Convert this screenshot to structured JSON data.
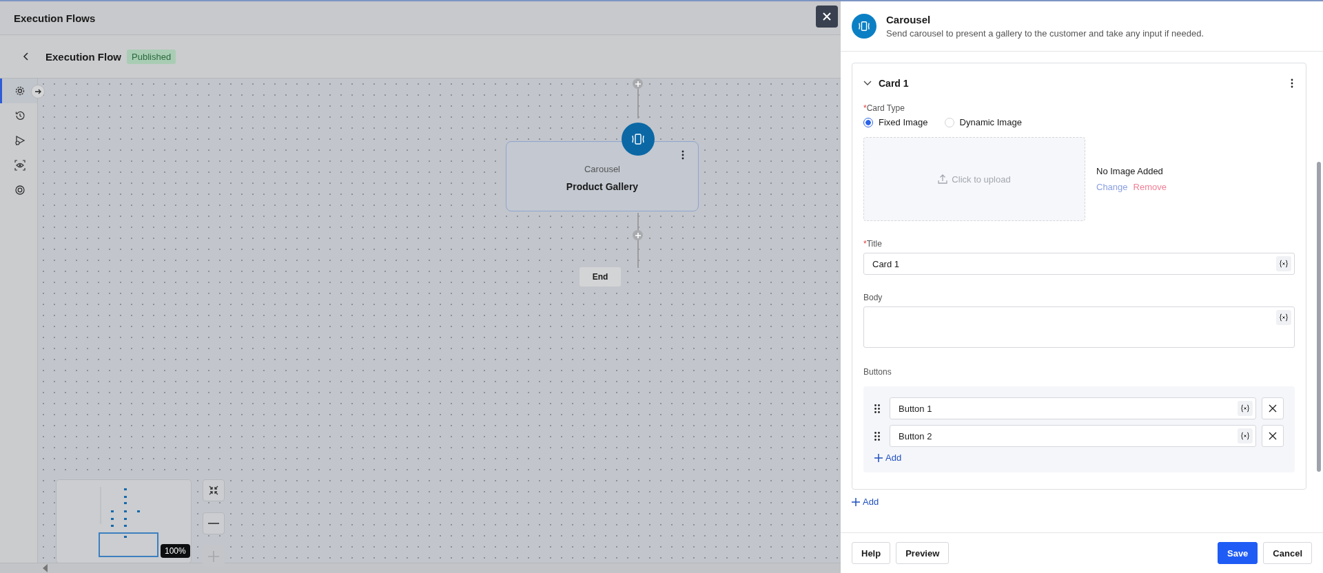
{
  "header": {
    "title": "Execution Flows"
  },
  "flow": {
    "title": "Execution Flow",
    "status": "Published"
  },
  "rail": [
    {
      "kind": "settings",
      "selected": true
    },
    {
      "kind": "history",
      "selected": false
    },
    {
      "kind": "run",
      "selected": false
    },
    {
      "kind": "preview",
      "selected": false
    },
    {
      "kind": "target",
      "selected": false
    }
  ],
  "canvas": {
    "node": {
      "type": "Carousel",
      "name": "Product Gallery"
    },
    "end": "End"
  },
  "zoom": {
    "reading": "100%",
    "zoom_in_disabled": true
  },
  "panel": {
    "title": "Carousel",
    "description": "Send carousel to present a gallery to the customer and take any input if needed.",
    "cards": [
      {
        "title": "Card 1",
        "expanded": true,
        "card_type": {
          "label": "Card Type",
          "marker": "*",
          "options": [
            {
              "label": "Fixed Image",
              "selected": true
            },
            {
              "label": "Dynamic Image",
              "selected": false
            }
          ]
        },
        "upload": "Click to upload",
        "image_status": "No Image Added",
        "change": "Change",
        "remove": "Remove",
        "title_field": {
          "label": "Title",
          "marker": "*",
          "value": "Card 1"
        },
        "body_field": {
          "label": "Body"
        },
        "buttons_label": "Buttons",
        "buttons": [
          {
            "value": "Button 1"
          },
          {
            "value": "Button 2"
          }
        ],
        "add_button": "Add"
      }
    ],
    "add_card": "Add",
    "footer": {
      "help": "Help",
      "preview": "Preview",
      "save": "Save",
      "cancel": "Cancel"
    }
  }
}
